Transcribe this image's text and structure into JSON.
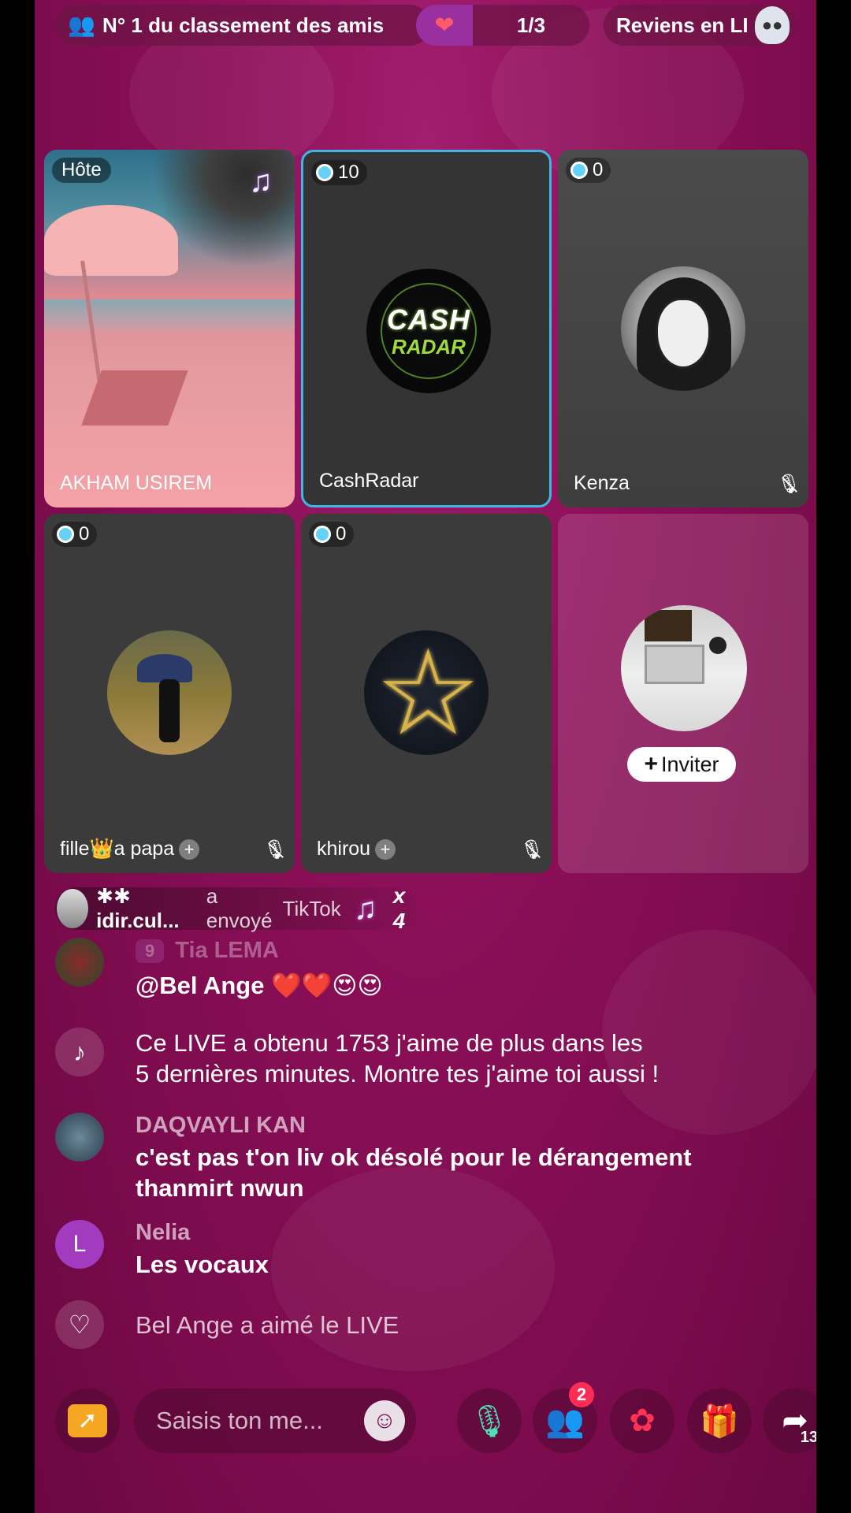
{
  "top": {
    "rank_label": "N° 1 du classement des amis",
    "page_indicator": "1/3",
    "back_label": "Reviens en LI"
  },
  "tiles": [
    {
      "name": "AKHAM USIREM",
      "tag": "Hôte"
    },
    {
      "name": "CashRadar",
      "score": "10",
      "logo_line1": "CASH",
      "logo_line2": "RADAR"
    },
    {
      "name": "Kenza",
      "score": "0"
    },
    {
      "name": "fille👑a papa",
      "score": "0"
    },
    {
      "name": "khirou",
      "score": "0"
    }
  ],
  "invite": {
    "label": "Inviter"
  },
  "gift_banner": {
    "sender": "✱✱ idir.cul...",
    "action": "a envoyé",
    "gift_name": "TikTok",
    "multiplier": "x 4"
  },
  "chat": [
    {
      "name": "Tia LEMA",
      "level": "9",
      "message": "@Bel Ange ❤️❤️😍😍"
    },
    {
      "system": true,
      "message_line1": "Ce LIVE a obtenu 1753 j'aime de plus dans les",
      "message_line2": "5 dernières minutes. Montre tes j'aime toi aussi !"
    },
    {
      "name": "DAQVAYLI KAN",
      "message_line1": "c'est pas t'on liv ok désolé pour le dérangement",
      "message_line2": "thanmirt nwun"
    },
    {
      "name": "Nelia",
      "avatar_letter": "L",
      "message": "Les vocaux"
    },
    {
      "system": true,
      "message": "Bel Ange a aimé le LIVE"
    }
  ],
  "toolbar": {
    "input_placeholder": "Saisis ton me...",
    "friends_badge": "2",
    "share_count": "13"
  },
  "colors": {
    "background": "#8b0f58",
    "accent_blue": "#3fb6e3",
    "badge_red": "#ff2d55"
  },
  "icons": [
    "friends-icon",
    "heart-gift-icon",
    "ghost-avatar-icon",
    "music-note-icon",
    "mute-icon",
    "tiktok-icon",
    "heart-icon",
    "share-arrow-icon",
    "mic-icon",
    "rose-icon",
    "gift-icon",
    "emoji-icon",
    "friends-check-icon"
  ]
}
